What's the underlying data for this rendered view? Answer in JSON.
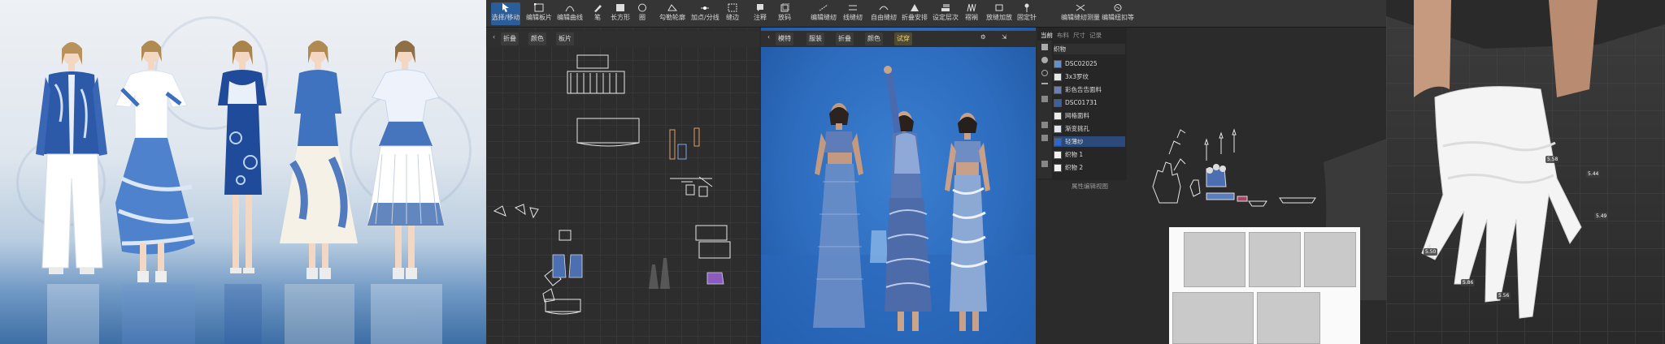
{
  "toolbar": {
    "tools": [
      {
        "label": "选择/移动",
        "icon": "cursor-icon",
        "active": true
      },
      {
        "label": "编辑板片",
        "icon": "edit-pattern-icon"
      },
      {
        "label": "编辑曲线",
        "icon": "edit-curve-icon"
      },
      {
        "label": "笔",
        "icon": "pen-icon"
      },
      {
        "label": "长方形",
        "icon": "rectangle-icon"
      },
      {
        "label": "圈",
        "icon": "circle-icon"
      },
      {
        "label": "勾勒轮廓",
        "icon": "trace-icon"
      },
      {
        "label": "加点/分线",
        "icon": "add-point-icon"
      },
      {
        "label": "缝边",
        "icon": "seam-icon"
      },
      {
        "label": "注释",
        "icon": "annotation-icon"
      },
      {
        "label": "放码",
        "icon": "grading-icon"
      },
      {
        "label": "编辑缝纫",
        "icon": "edit-sewing-icon"
      },
      {
        "label": "线缝纫",
        "icon": "line-sewing-icon"
      },
      {
        "label": "自由缝纫",
        "icon": "free-sewing-icon"
      },
      {
        "label": "折叠安排",
        "icon": "fold-icon"
      },
      {
        "label": "设定层次",
        "icon": "layer-icon"
      },
      {
        "label": "褶裥",
        "icon": "pleat-icon"
      },
      {
        "label": "放缝加放",
        "icon": "allowance-icon"
      },
      {
        "label": "固定针",
        "icon": "pin-icon"
      },
      {
        "label": "编辑缝纫测量",
        "icon": "measure-icon"
      },
      {
        "label": "编辑纽扣等",
        "icon": "button-icon"
      }
    ]
  },
  "view2d": {
    "subbar": [
      "折叠",
      "颜色",
      "板片"
    ]
  },
  "view3d": {
    "subbar": [
      "模特",
      "服装",
      "折叠",
      "颜色",
      "试穿"
    ]
  },
  "object_browser": {
    "tabs": [
      "当前",
      "布料",
      "尺寸",
      "记录"
    ],
    "header": "织物",
    "items": [
      {
        "label": "DSC02025",
        "color": "#6a8fc7"
      },
      {
        "label": "3x3罗纹",
        "color": "#e8e8e8"
      },
      {
        "label": "彩色告告面料",
        "color": "#6c7fb2"
      },
      {
        "label": "DSC01731",
        "color": "#3f5f9e"
      },
      {
        "label": "网格面料",
        "color": "#ededed"
      },
      {
        "label": "渐变挑孔",
        "color": "#e2e6ee"
      },
      {
        "label": "轻薄纱",
        "color": "#2f66c9"
      },
      {
        "label": "织物 1",
        "color": "#f2f2f2"
      },
      {
        "label": "织物 2",
        "color": "#f2f2f2"
      }
    ],
    "footer": "属性编辑视图"
  },
  "glove_measurements": [
    "5.58",
    "5.44",
    "5.50",
    "5.86",
    "5.56",
    "5.49"
  ],
  "colors": {
    "accent": "#2b5d9a",
    "avatar_bg": "#2d6cbe"
  }
}
